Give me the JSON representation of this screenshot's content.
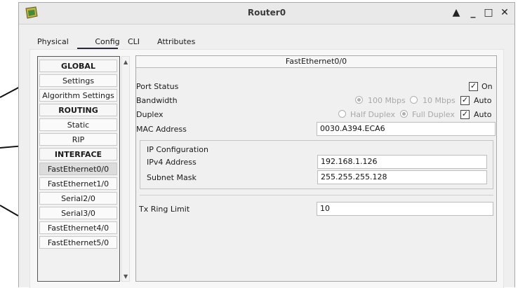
{
  "window": {
    "title": "Router0"
  },
  "window_controls": {
    "maximize_glyph": "▲",
    "minimize_glyph": "_",
    "restore_glyph": "□",
    "close_glyph": "✕"
  },
  "tabs": [
    {
      "label": "Physical"
    },
    {
      "label": "Config",
      "active": true
    },
    {
      "label": "CLI"
    },
    {
      "label": "Attributes"
    }
  ],
  "sidebar": {
    "items": [
      {
        "label": "GLOBAL",
        "type": "header"
      },
      {
        "label": "Settings"
      },
      {
        "label": "Algorithm Settings"
      },
      {
        "label": "ROUTING",
        "type": "header"
      },
      {
        "label": "Static"
      },
      {
        "label": "RIP"
      },
      {
        "label": "INTERFACE",
        "type": "header"
      },
      {
        "label": "FastEthernet0/0",
        "selected": true
      },
      {
        "label": "FastEthernet1/0"
      },
      {
        "label": "Serial2/0"
      },
      {
        "label": "Serial3/0"
      },
      {
        "label": "FastEthernet4/0"
      },
      {
        "label": "FastEthernet5/0"
      }
    ],
    "scroll_up": "▲",
    "scroll_down": "▼"
  },
  "interface": {
    "name": "FastEthernet0/0",
    "port_status": {
      "label": "Port Status",
      "on_label": "On",
      "checked": true
    },
    "bandwidth": {
      "label": "Bandwidth",
      "option_100": "100 Mbps",
      "option_10": "10 Mbps",
      "auto_label": "Auto",
      "auto_checked": true
    },
    "duplex": {
      "label": "Duplex",
      "option_half": "Half Duplex",
      "option_full": "Full Duplex",
      "auto_label": "Auto",
      "auto_checked": true
    },
    "mac": {
      "label": "MAC Address",
      "value": "0030.A394.ECA6"
    },
    "ip_config": {
      "title": "IP Configuration",
      "ipv4_label": "IPv4 Address",
      "ipv4_value": "192.168.1.126",
      "mask_label": "Subnet Mask",
      "mask_value": "255.255.255.128"
    },
    "tx_ring": {
      "label": "Tx Ring Limit",
      "value": "10"
    },
    "check_glyph": "✓"
  }
}
